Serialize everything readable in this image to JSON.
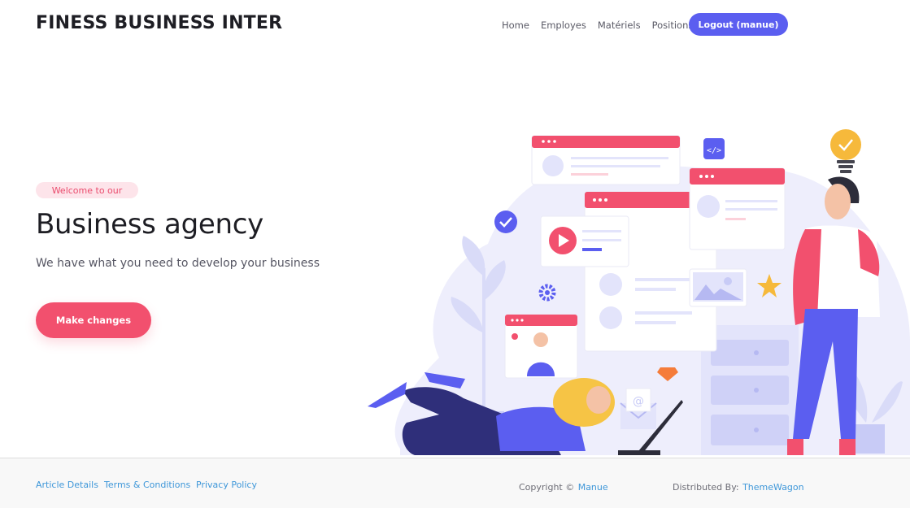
{
  "header": {
    "brand": "FINESS BUSINESS INTER",
    "nav": [
      "Home",
      "Employes",
      "Matériels",
      "Positions"
    ],
    "logout_label": "Logout (manue)"
  },
  "hero": {
    "badge": "Welcome to our",
    "title": "Business agency",
    "subtitle": "We have what you need to develop your business",
    "cta_label": "Make changes"
  },
  "footer": {
    "links": [
      "Article Details",
      "Terms & Conditions",
      "Privacy Policy"
    ],
    "copyright_prefix": "Copyright ©",
    "copyright_name": "Manue",
    "distributed_prefix": "Distributed By:",
    "distributed_name": "ThemeWagon"
  },
  "colors": {
    "primary": "#5b5ef0",
    "accent": "#f2506e",
    "link": "#3e97d9",
    "badge_bg": "#fde4ea",
    "illustration_blob": "#eeeefc"
  },
  "icons": [
    "check-circle-icon",
    "code-icon",
    "lightbulb-icon",
    "play-icon",
    "gear-icon",
    "star-icon",
    "diamond-icon",
    "mail-icon",
    "image-icon"
  ]
}
